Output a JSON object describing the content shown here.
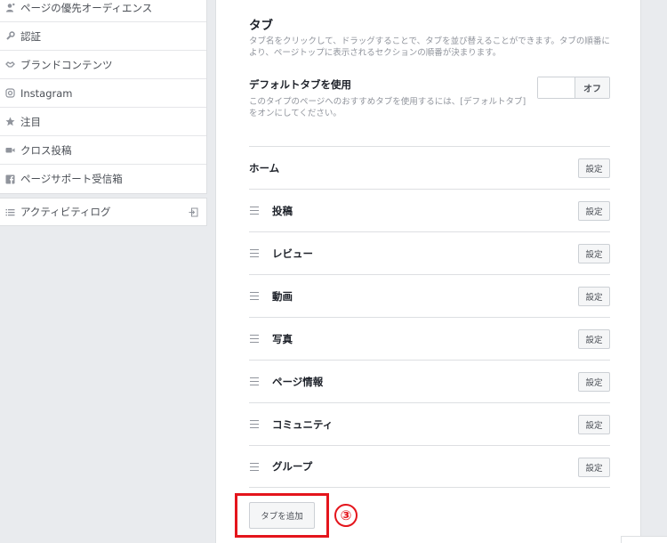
{
  "sidebar": {
    "items": [
      {
        "label": "ページの優先オーディエンス",
        "icon": "audience-icon"
      },
      {
        "label": "認証",
        "icon": "wrench-icon"
      },
      {
        "label": "ブランドコンテンツ",
        "icon": "handshake-icon"
      },
      {
        "label": "Instagram",
        "icon": "instagram-icon"
      },
      {
        "label": "注目",
        "icon": "star-icon"
      },
      {
        "label": "クロス投稿",
        "icon": "video-camera-icon"
      },
      {
        "label": "ページサポート受信箱",
        "icon": "facebook-icon"
      }
    ],
    "activity_log": {
      "label": "アクティビティログ",
      "icon": "list-icon"
    }
  },
  "tabs_section": {
    "title": "タブ",
    "description": "タブ名をクリックして、ドラッグすることで、タブを並び替えることができます。タブの順番により、ページトップに表示されるセクションの順番が決まります。",
    "default_tabs": {
      "title": "デフォルトタブを使用",
      "description": "このタイプのページへのおすすめタブを使用するには、[デフォルトタブ]をオンにしてください。",
      "toggle_label": "オフ",
      "enabled": false
    },
    "tabs": [
      {
        "name": "ホーム",
        "draggable": false,
        "button": "設定"
      },
      {
        "name": "投稿",
        "draggable": true,
        "button": "設定"
      },
      {
        "name": "レビュー",
        "draggable": true,
        "button": "設定"
      },
      {
        "name": "動画",
        "draggable": true,
        "button": "設定"
      },
      {
        "name": "写真",
        "draggable": true,
        "button": "設定"
      },
      {
        "name": "ページ情報",
        "draggable": true,
        "button": "設定"
      },
      {
        "name": "コミュニティ",
        "draggable": true,
        "button": "設定"
      },
      {
        "name": "グループ",
        "draggable": true,
        "button": "設定"
      }
    ],
    "add_tab_label": "タブを追加"
  },
  "annotation": {
    "step_marker": "③",
    "color": "#e4151c"
  }
}
